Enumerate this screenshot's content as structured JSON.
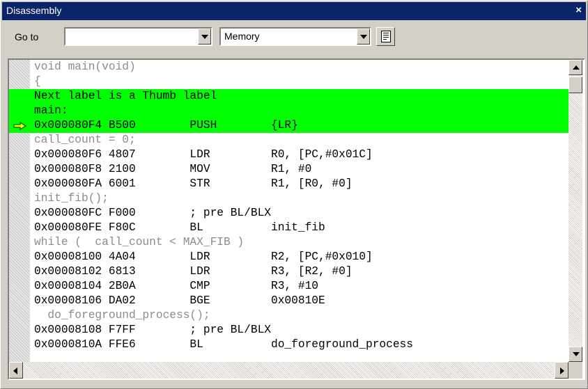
{
  "window": {
    "title": "Disassembly",
    "close_label": "×"
  },
  "toolbar": {
    "goto_label": "Go to",
    "goto_value": "",
    "mode_value": "Memory"
  },
  "colors": {
    "title_bar": "#0a246a",
    "current_pc_highlight": "#00ff00",
    "source_text": "#8c8c8c"
  },
  "icons": {
    "toolbar_button": "document-icon",
    "current_pc": "arrow-right-icon"
  },
  "code": {
    "lines": [
      {
        "kind": "source",
        "text": "void main(void)"
      },
      {
        "kind": "source",
        "text": "{"
      },
      {
        "kind": "label",
        "text": "Next label is a Thumb label",
        "highlight": true
      },
      {
        "kind": "label",
        "text": "main:",
        "highlight": true
      },
      {
        "kind": "asm",
        "text": "0x000080F4 B500        PUSH        {LR}",
        "highlight": true,
        "current": true
      },
      {
        "kind": "source",
        "text": "call_count = 0;"
      },
      {
        "kind": "asm",
        "text": "0x000080F6 4807        LDR         R0, [PC,#0x01C]"
      },
      {
        "kind": "asm",
        "text": "0x000080F8 2100        MOV         R1, #0"
      },
      {
        "kind": "asm",
        "text": "0x000080FA 6001        STR         R1, [R0, #0]"
      },
      {
        "kind": "source",
        "text": "init_fib();"
      },
      {
        "kind": "asm",
        "text": "0x000080FC F000        ; pre BL/BLX"
      },
      {
        "kind": "asm",
        "text": "0x000080FE F80C        BL          init_fib"
      },
      {
        "kind": "source",
        "text": "while (  call_count < MAX_FIB )"
      },
      {
        "kind": "asm",
        "text": "0x00008100 4A04        LDR         R2, [PC,#0x010]"
      },
      {
        "kind": "asm",
        "text": "0x00008102 6813        LDR         R3, [R2, #0]"
      },
      {
        "kind": "asm",
        "text": "0x00008104 2B0A        CMP         R3, #10"
      },
      {
        "kind": "asm",
        "text": "0x00008106 DA02        BGE         0x00810E"
      },
      {
        "kind": "source",
        "text": "  do_foreground_process();"
      },
      {
        "kind": "asm",
        "text": "0x00008108 F7FF        ; pre BL/BLX"
      },
      {
        "kind": "asm",
        "text": "0x0000810A FFE6        BL          do_foreground_process"
      }
    ]
  }
}
